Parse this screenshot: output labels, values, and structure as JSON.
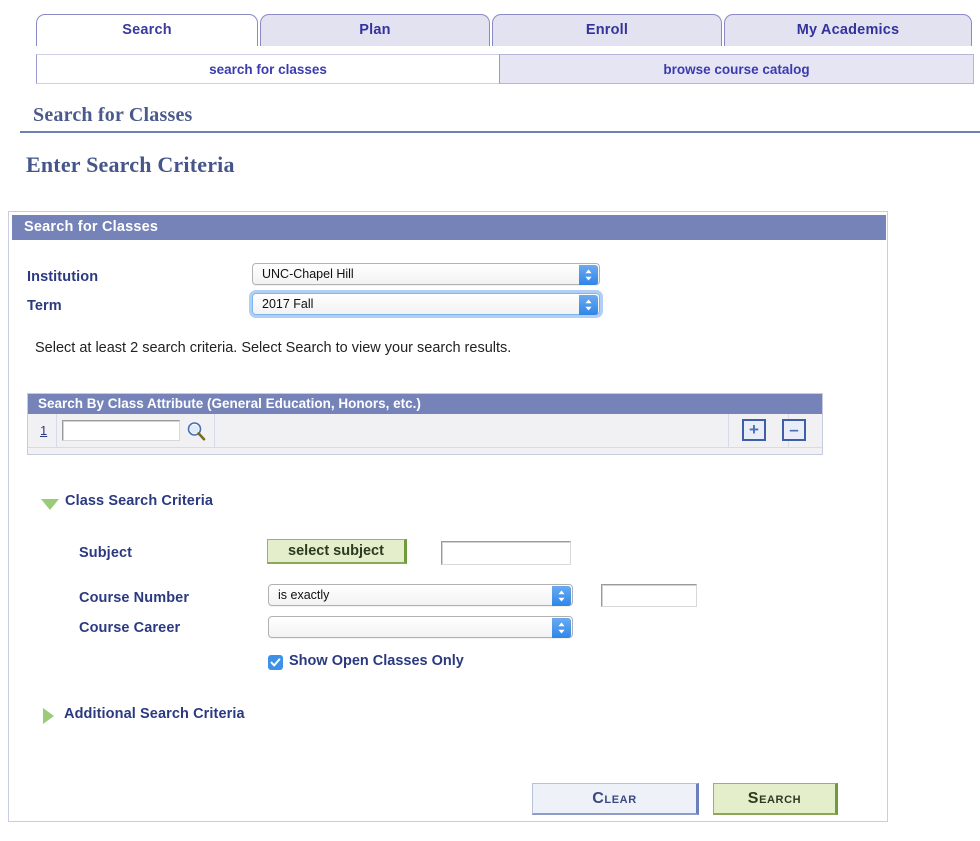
{
  "tabs": [
    {
      "label": "Search",
      "active": true
    },
    {
      "label": "Plan",
      "active": false
    },
    {
      "label": "Enroll",
      "active": false
    },
    {
      "label": "My Academics",
      "active": false
    }
  ],
  "subtabs": [
    {
      "label": "search for classes",
      "active": true
    },
    {
      "label": "browse course catalog",
      "active": false
    }
  ],
  "page": {
    "title": "Search for Classes",
    "section_title": "Enter Search Criteria"
  },
  "panel": {
    "header": "Search for Classes",
    "institution": {
      "label": "Institution",
      "value": "UNC-Chapel Hill",
      "focused": false
    },
    "term": {
      "label": "Term",
      "value": "2017 Fall",
      "focused": true
    },
    "hint": "Select at least 2 search criteria. Select Search to view your search results."
  },
  "class_attribute": {
    "header": "Search By Class Attribute (General Education, Honors, etc.)",
    "rows": [
      {
        "num": "1",
        "value": "",
        "lookup_icon": "magnifier-icon"
      }
    ],
    "add_label": "+",
    "remove_label": "–"
  },
  "class_search_criteria": {
    "title": "Class Search Criteria",
    "expanded": true,
    "subject": {
      "label": "Subject",
      "button_label": "select subject",
      "value": ""
    },
    "course_number": {
      "label": "Course Number",
      "operator": "is exactly",
      "value": ""
    },
    "course_career": {
      "label": "Course Career",
      "value": ""
    },
    "show_open_only": {
      "label": "Show Open Classes Only",
      "checked": true
    }
  },
  "additional_search_criteria": {
    "title": "Additional Search Criteria",
    "expanded": false
  },
  "actions": {
    "clear_label": "Clear",
    "search_label": "Search"
  },
  "colors": {
    "header_bar": "#7683b8",
    "tab_inactive": "#e3e2f0",
    "tab_text": "#33339e",
    "green_button": "#e4eecb",
    "green_border": "#6f9b3a",
    "blue_button": "#eef1f8",
    "blue_border": "#6d7fba",
    "checkbox": "#3d92e8",
    "triangle": "#9acb78",
    "label_text": "#2b3a80",
    "title_text": "#46568a"
  }
}
